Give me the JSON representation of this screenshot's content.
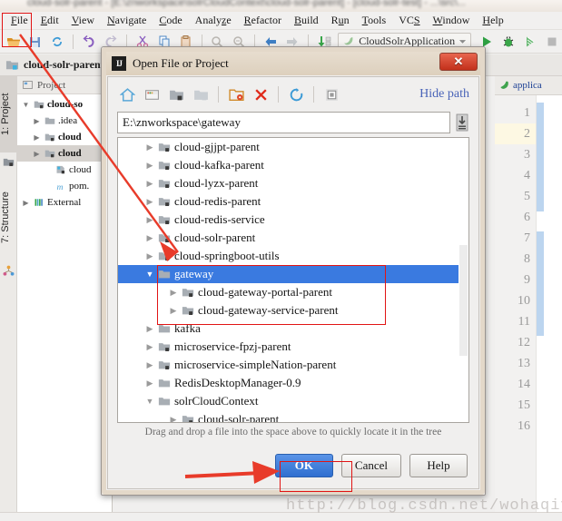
{
  "ide": {
    "window_title": "cloud-solr-parent - [E:\\znworkspace\\solrCloudContext\\cloud-solr-parent] - [cloud-solr-test] - ...\\src\\...",
    "menubar": [
      {
        "label": "File",
        "mnemonic": "F"
      },
      {
        "label": "Edit",
        "mnemonic": "E"
      },
      {
        "label": "View",
        "mnemonic": "V"
      },
      {
        "label": "Navigate",
        "mnemonic": "N"
      },
      {
        "label": "Code",
        "mnemonic": "C"
      },
      {
        "label": "Analyze",
        "mnemonic": "z"
      },
      {
        "label": "Refactor",
        "mnemonic": "R"
      },
      {
        "label": "Build",
        "mnemonic": "B"
      },
      {
        "label": "Run",
        "mnemonic": "u"
      },
      {
        "label": "Tools",
        "mnemonic": "T"
      },
      {
        "label": "VCS",
        "mnemonic": "S"
      },
      {
        "label": "Window",
        "mnemonic": "W"
      },
      {
        "label": "Help",
        "mnemonic": "H"
      }
    ],
    "toolbar": {
      "buttons": [
        "open-folder-icon",
        "save-all-icon",
        "sync-icon",
        "undo-icon",
        "redo-icon",
        "cut-icon",
        "copy-icon",
        "paste-icon",
        "find-icon",
        "replace-icon",
        "back-icon",
        "forward-icon",
        "update-project-icon"
      ],
      "run_configuration": "CloudSolrApplication",
      "run_icon": "run-icon",
      "debug_icon": "debug-icon",
      "coverage_icon": "run-with-coverage-icon",
      "stop_icon": "stop-icon"
    },
    "breadcrumb": "cloud-solr-parent",
    "left_tabs": [
      {
        "label": "1: Project",
        "selected": true
      },
      {
        "label": "7: Structure",
        "selected": false
      }
    ],
    "project_panel": {
      "tab_label": "Project",
      "tree": [
        {
          "label": "cloud-so",
          "depth": 0,
          "twisty": "down",
          "icon": "module-folder-icon",
          "bold": true,
          "selected": false
        },
        {
          "label": ".idea",
          "depth": 1,
          "twisty": "right",
          "icon": "folder-icon",
          "bold": false,
          "selected": false
        },
        {
          "label": "cloud",
          "depth": 1,
          "twisty": "right",
          "icon": "module-folder-icon",
          "bold": true,
          "selected": false
        },
        {
          "label": "cloud",
          "depth": 1,
          "twisty": "right",
          "icon": "module-folder-icon",
          "bold": true,
          "selected": true
        },
        {
          "label": "cloud",
          "depth": 2,
          "twisty": "none",
          "icon": "module-icon",
          "bold": false,
          "selected": false
        },
        {
          "label": "pom.",
          "depth": 2,
          "twisty": "none",
          "icon": "maven-icon",
          "bold": false,
          "selected": false
        },
        {
          "label": "External",
          "depth": 0,
          "twisty": "right",
          "icon": "libraries-icon",
          "bold": false,
          "selected": false
        }
      ]
    },
    "editor": {
      "tab_name": "applica",
      "tab_icon": "spring-leaf-icon",
      "line_numbers": [
        "1",
        "2",
        "3",
        "4",
        "5",
        "6",
        "7",
        "8",
        "9",
        "10",
        "11",
        "12",
        "13",
        "14",
        "15",
        "16"
      ],
      "highlighted_line": "2"
    }
  },
  "dialog": {
    "title": "Open File or Project",
    "icon": "intellij-icon",
    "close_label": "✕",
    "toolbar": [
      {
        "name": "home-icon"
      },
      {
        "name": "desktop-icon"
      },
      {
        "name": "project-dir-icon"
      },
      {
        "name": "module-dir-icon"
      },
      {
        "name": "new-folder-icon"
      },
      {
        "name": "delete-icon"
      },
      {
        "name": "refresh-icon"
      },
      {
        "name": "show-hidden-icon"
      }
    ],
    "hide_path_label": "Hide path",
    "path_value": "E:\\znworkspace\\gateway",
    "path_placeholder": "E:\\znworkspace\\gateway",
    "path_history_icon": "drop-history-icon",
    "tree": [
      {
        "label": "cloud-gjjpt-parent",
        "depth": 1,
        "twisty": "right",
        "icon": "module-folder-icon",
        "selected": false
      },
      {
        "label": "cloud-kafka-parent",
        "depth": 1,
        "twisty": "right",
        "icon": "module-folder-icon",
        "selected": false
      },
      {
        "label": "cloud-lyzx-parent",
        "depth": 1,
        "twisty": "right",
        "icon": "module-folder-icon",
        "selected": false
      },
      {
        "label": "cloud-redis-parent",
        "depth": 1,
        "twisty": "right",
        "icon": "module-folder-icon",
        "selected": false
      },
      {
        "label": "cloud-redis-service",
        "depth": 1,
        "twisty": "right",
        "icon": "module-folder-icon",
        "selected": false
      },
      {
        "label": "cloud-solr-parent",
        "depth": 1,
        "twisty": "right",
        "icon": "module-folder-icon",
        "selected": false
      },
      {
        "label": "cloud-springboot-utils",
        "depth": 1,
        "twisty": "right",
        "icon": "module-folder-icon",
        "selected": false
      },
      {
        "label": "gateway",
        "depth": 1,
        "twisty": "down",
        "icon": "folder-icon",
        "selected": true
      },
      {
        "label": "cloud-gateway-portal-parent",
        "depth": 2,
        "twisty": "right",
        "icon": "module-folder-icon",
        "selected": false
      },
      {
        "label": "cloud-gateway-service-parent",
        "depth": 2,
        "twisty": "right",
        "icon": "module-folder-icon",
        "selected": false
      },
      {
        "label": "kafka",
        "depth": 1,
        "twisty": "right",
        "icon": "folder-icon",
        "selected": false
      },
      {
        "label": "microservice-fpzj-parent",
        "depth": 1,
        "twisty": "right",
        "icon": "module-folder-icon",
        "selected": false
      },
      {
        "label": "microservice-simpleNation-parent",
        "depth": 1,
        "twisty": "right",
        "icon": "module-folder-icon",
        "selected": false
      },
      {
        "label": "RedisDesktopManager-0.9",
        "depth": 1,
        "twisty": "right",
        "icon": "folder-icon",
        "selected": false
      },
      {
        "label": "solrCloudContext",
        "depth": 1,
        "twisty": "down",
        "icon": "folder-icon",
        "selected": false
      },
      {
        "label": "cloud-solr-parent",
        "depth": 2,
        "twisty": "right",
        "icon": "module-folder-icon",
        "selected": false
      }
    ],
    "drag_hint": "Drag and drop a file into the space above to quickly locate it in the tree",
    "buttons": [
      {
        "label": "OK",
        "primary": true
      },
      {
        "label": "Cancel",
        "primary": false
      },
      {
        "label": "Help",
        "primary": false
      }
    ]
  },
  "annotations": {
    "watermark": "http://blog.csdn.net/wohaqiyi",
    "highlight_color": "#e11414"
  }
}
